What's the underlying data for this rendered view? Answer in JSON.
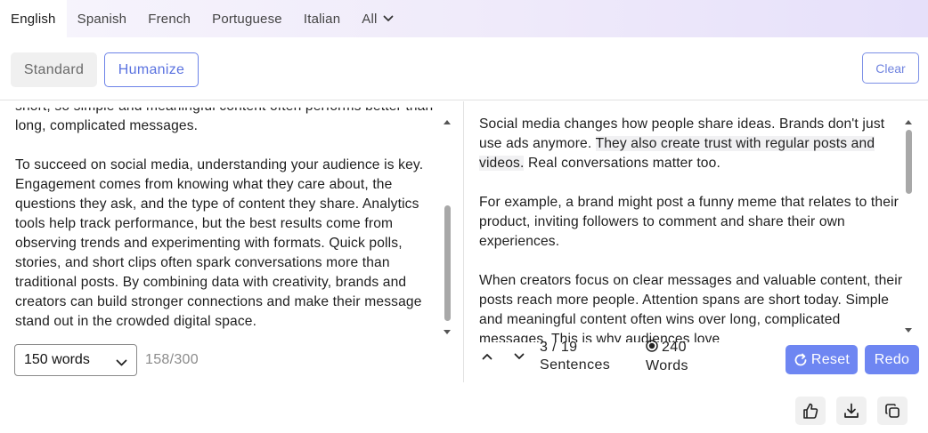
{
  "languages": [
    {
      "label": "English",
      "active": true
    },
    {
      "label": "Spanish",
      "active": false
    },
    {
      "label": "French",
      "active": false
    },
    {
      "label": "Portuguese",
      "active": false
    },
    {
      "label": "Italian",
      "active": false
    },
    {
      "label": "All",
      "active": false
    }
  ],
  "modes": {
    "standard": "Standard",
    "humanize": "Humanize"
  },
  "clear_label": "Clear",
  "input": {
    "paragraphs": [
      "short, so simple and meaningful content often performs better than long, complicated messages.",
      "To succeed on social media, understanding your audience is key. Engagement comes from knowing what they care about, the questions they ask, and the type of content they share. Analytics tools help track performance, but the best results come from observing trends and experimenting with formats. Quick polls, stories, and short clips often spark conversations more than traditional posts. By combining data with creativity, brands and creators can build stronger connections and make their message stand out in the crowded digital space."
    ],
    "word_limit": "150 words",
    "char_count": "158/300"
  },
  "output": {
    "p1_start": "Social media changes how people share ideas. Brands don't just use ads anymore.",
    "p1_highlight": "They also create trust with regular posts and videos.",
    "p1_end": "Real conversations matter too.",
    "p2": "For example, a brand might post a funny meme that relates to their product, inviting followers to comment and share their own experiences.",
    "p3": "When creators focus on clear messages and valuable content, their posts reach more people. Attention spans are short today. Simple and meaningful content often wins over long, complicated messages. This is why audiences love",
    "sentences_count": "3 / 19",
    "sentences_label": "Sentences",
    "words_count": "240",
    "words_label": "Words",
    "reset_label": "Reset",
    "redo_label": "Redo"
  },
  "icons": {
    "chevron": "chevron-down-icon",
    "up": "chevron-up-icon",
    "reset": "refresh-icon",
    "like": "thumbs-up-icon",
    "download": "download-icon",
    "copy": "copy-icon"
  },
  "colors": {
    "accent": "#6e86f2",
    "border_accent": "#6d83e8"
  }
}
